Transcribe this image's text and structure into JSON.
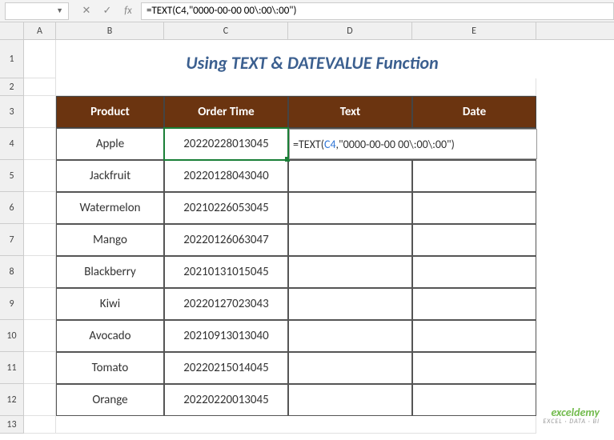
{
  "name_box": "",
  "formula_bar": "=TEXT(C4,\"0000-00-00 00\\:00\\:00\")",
  "columns": [
    "A",
    "B",
    "C",
    "D",
    "E"
  ],
  "rows": [
    "1",
    "2",
    "3",
    "4",
    "5",
    "6",
    "7",
    "8",
    "9",
    "10",
    "11",
    "12",
    "13"
  ],
  "title": "Using TEXT & DATEVALUE Function",
  "headers": {
    "product": "Product",
    "order_time": "Order Time",
    "text": "Text",
    "date": "Date"
  },
  "data": [
    {
      "product": "Apple",
      "order_time": "20220228013045"
    },
    {
      "product": "Jackfruit",
      "order_time": "20220128043040"
    },
    {
      "product": "Watermelon",
      "order_time": "20210226053045"
    },
    {
      "product": "Mango",
      "order_time": "20220126063047"
    },
    {
      "product": "Blackberry",
      "order_time": "20210131015045"
    },
    {
      "product": "Kiwi",
      "order_time": "20220127023043"
    },
    {
      "product": "Avocado",
      "order_time": "20210913013040"
    },
    {
      "product": "Tomato",
      "order_time": "20220215014045"
    },
    {
      "product": "Orange",
      "order_time": "20220220013045"
    }
  ],
  "editing_cell_display": {
    "prefix": "=",
    "func": "TEXT",
    "paren": "(",
    "ref": "C4",
    "rest": ",\"0000-00-00 00\\:00\\:00\")"
  },
  "watermark": {
    "brand": "exceldemy",
    "tag": "EXCEL · DATA · BI"
  },
  "chart_data": {
    "type": "table",
    "title": "Using TEXT & DATEVALUE Function",
    "columns": [
      "Product",
      "Order Time",
      "Text",
      "Date"
    ],
    "rows": [
      [
        "Apple",
        "20220228013045",
        "",
        ""
      ],
      [
        "Jackfruit",
        "20220128043040",
        "",
        ""
      ],
      [
        "Watermelon",
        "20210226053045",
        "",
        ""
      ],
      [
        "Mango",
        "20220126063047",
        "",
        ""
      ],
      [
        "Blackberry",
        "20210131015045",
        "",
        ""
      ],
      [
        "Kiwi",
        "20220127023043",
        "",
        ""
      ],
      [
        "Avocado",
        "20210913013040",
        "",
        ""
      ],
      [
        "Tomato",
        "20220215014045",
        "",
        ""
      ],
      [
        "Orange",
        "20220220013045",
        "",
        ""
      ]
    ]
  }
}
